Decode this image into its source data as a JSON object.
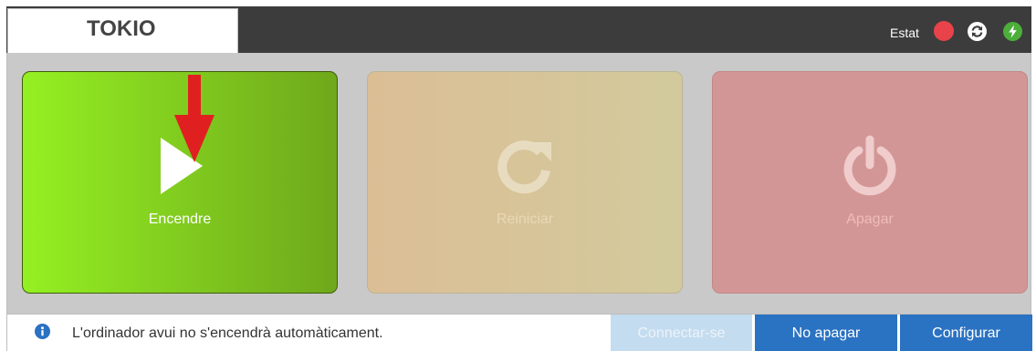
{
  "header": {
    "title": "TOKIO",
    "status_label": "Estat",
    "status_color": "#e8434a",
    "icons": [
      "sync-icon",
      "bolt-icon"
    ]
  },
  "actions": [
    {
      "label": "Encendre",
      "icon": "play-icon",
      "enabled": true
    },
    {
      "label": "Reiniciar",
      "icon": "restart-icon",
      "enabled": false
    },
    {
      "label": "Apagar",
      "icon": "power-icon",
      "enabled": false
    }
  ],
  "footer": {
    "info_text": "L'ordinador avui no s'encendrà automàticament.",
    "buttons": {
      "connect": "Connectar-se",
      "no_shutdown": "No apagar",
      "configure": "Configurar"
    }
  },
  "colors": {
    "accent_blue": "#2a72c2",
    "header_bg": "#3c3c3c",
    "on_green": "#94f022"
  }
}
